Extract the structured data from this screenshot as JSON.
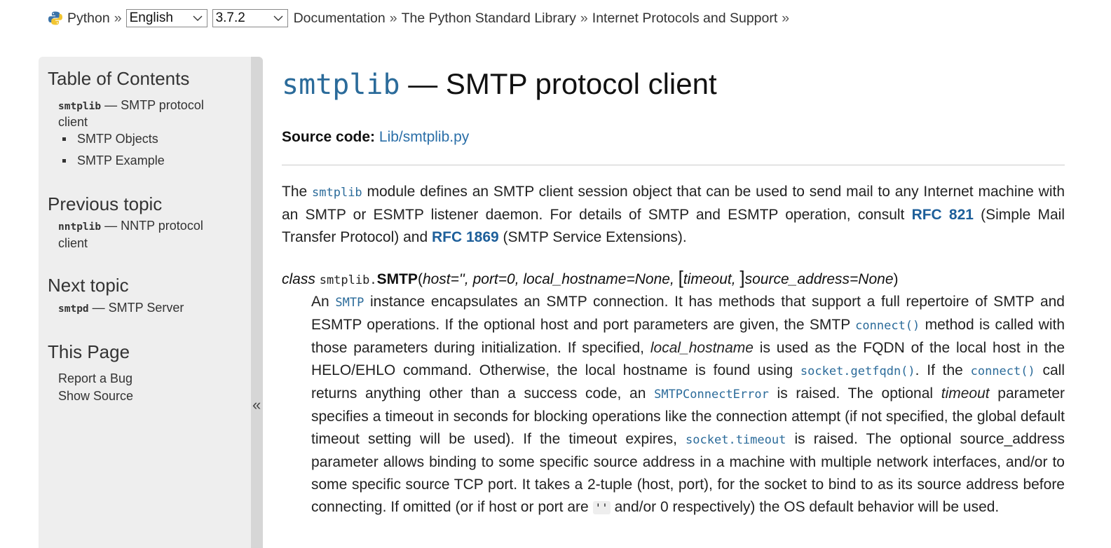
{
  "topnav": {
    "python": "Python",
    "sep": "»",
    "language": "English",
    "version": "3.7.2",
    "crumb_docs": "Documentation",
    "crumb_stdlib": "The Python Standard Library",
    "crumb_internet": "Internet Protocols and Support"
  },
  "sidebar": {
    "toc_heading": "Table of Contents",
    "toc_main_code": "smtplib",
    "toc_main_text": " — SMTP protocol",
    "toc_main_text2": "client",
    "toc_sub1": "SMTP Objects",
    "toc_sub2": "SMTP Example",
    "prev_heading": "Previous topic",
    "prev_code": "nntplib",
    "prev_text": " — NNTP protocol",
    "prev_text2": "client",
    "next_heading": "Next topic",
    "next_code": "smtpd",
    "next_text": " — SMTP Server",
    "page_heading": "This Page",
    "report_bug": "Report a Bug",
    "show_source": "Show Source",
    "collapse": "«"
  },
  "main": {
    "title_code": "smtplib",
    "title_text": " — SMTP protocol client",
    "source_label": "Source code:",
    "source_link": "Lib/smtplib.py",
    "p1": {
      "t1": "The ",
      "code1": "smtplib",
      "t2": " module defines an SMTP client session object that can be used to send mail to any Internet machine with an SMTP or ESMTP listener daemon. For details of SMTP and ESMTP operation, consult ",
      "rfc1": "RFC 821",
      "t3": " (Simple Mail Transfer Protocol) and ",
      "rfc2": "RFC 1869",
      "t4": " (SMTP Service Extensions)."
    },
    "sig": {
      "kw": "class",
      "mod": "smtplib.",
      "name": "SMTP",
      "open": "(",
      "params1": "host='', port=0, local_hostname=None, ",
      "brk_open": "[",
      "timeout": "timeout, ",
      "brk_close": "]",
      "params2": "source_address=None",
      "close": ")"
    },
    "p2": {
      "t1": "An ",
      "c1": "SMTP",
      "t2": " instance encapsulates an SMTP connection. It has methods that support a full repertoire of SMTP and ESMTP operations. If the optional host and port parameters are given, the SMTP ",
      "c2": "connect()",
      "t3": " method is called with those parameters during initialization. If specified, ",
      "i1": "local_hostname",
      "t4": " is used as the FQDN of the local host in the HELO/EHLO command. Otherwise, the local hostname is found using ",
      "c3": "socket.getfqdn()",
      "t5": ". If the ",
      "c4": "connect()",
      "t6": " call returns anything other than a success code, an ",
      "c5": "SMTPConnectError",
      "t7": " is raised. The optional ",
      "i2": "timeout",
      "t8": " parameter specifies a timeout in seconds for blocking operations like the connection attempt (if not specified, the global default timeout setting will be used). If the timeout expires, ",
      "c6": "socket.timeout",
      "t9": " is raised. The optional source_address parameter allows binding to some specific source address in a machine with multiple network interfaces, and/or to some specific source TCP port. It takes a 2-tuple (host, port), for the socket to bind to as its source address before connecting. If omitted (or if host or port are ",
      "lit": "''",
      "t10": " and/or 0 respectively) the OS default behavior will be used."
    }
  }
}
